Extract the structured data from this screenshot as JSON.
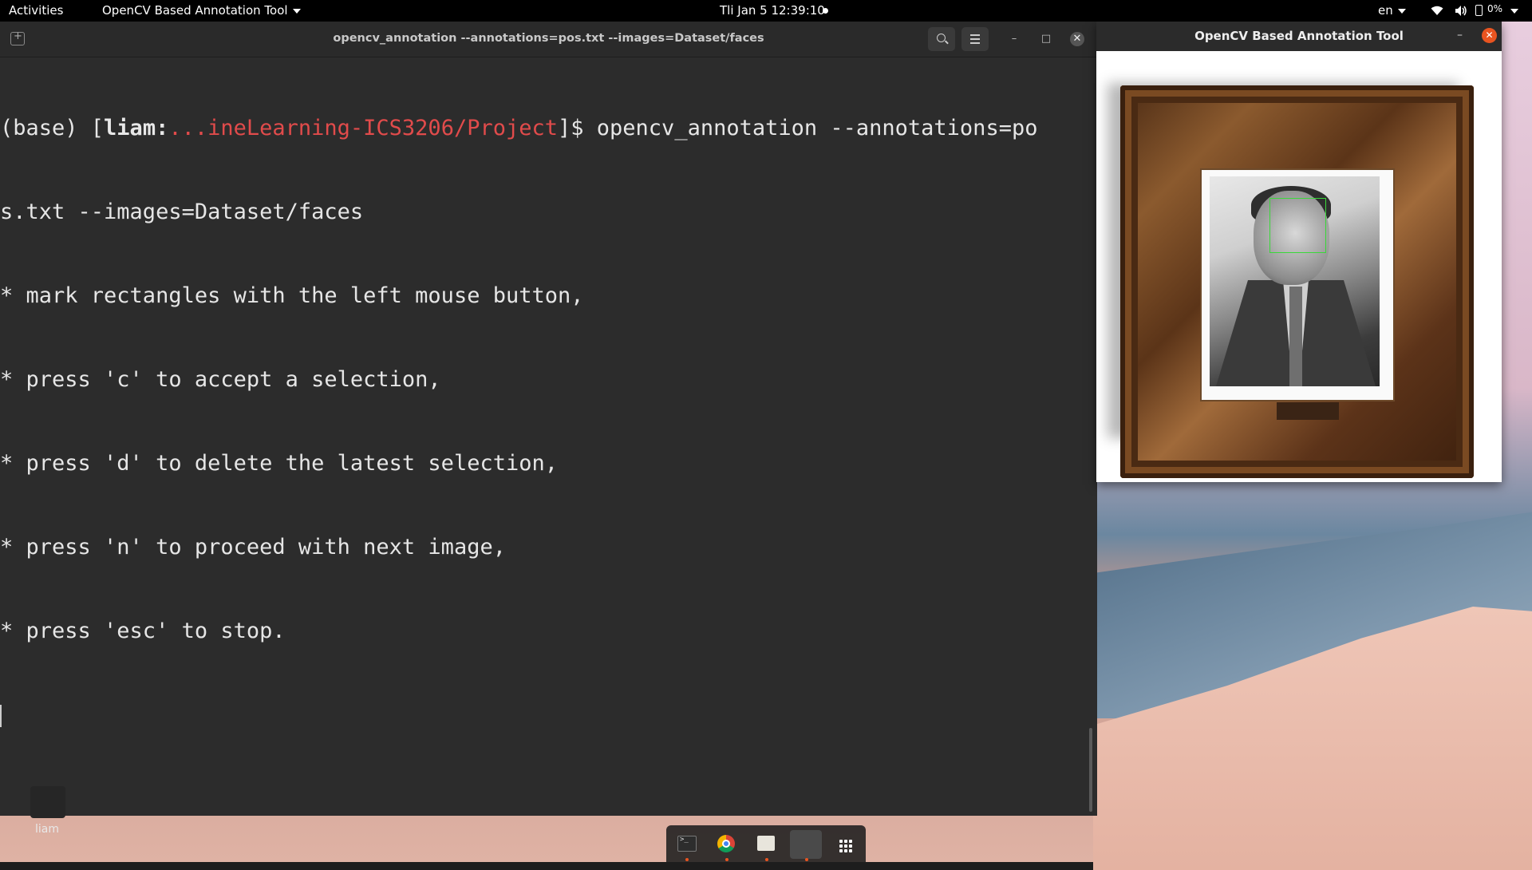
{
  "topbar": {
    "activities": "Activities",
    "app_menu": "OpenCV Based Annotation Tool",
    "clock": "Tli Jan 5  12:39:10",
    "language": "en",
    "battery": "0%"
  },
  "terminal": {
    "title": "opencv_annotation --annotations=pos.txt --images=Dataset/faces",
    "prompt_env": "(base) [",
    "prompt_user": "liam:",
    "prompt_path": "...ineLearning-ICS3206/Project",
    "prompt_end": "]$ ",
    "command_part1": "opencv_annotation --annotations=po",
    "command_part2": "s.txt --images=Dataset/faces",
    "output": [
      "* mark rectangles with the left mouse button,",
      "* press 'c' to accept a selection,",
      "* press 'd' to delete the latest selection,",
      "* press 'n' to proceed with next image,",
      "* press 'esc' to stop."
    ]
  },
  "annotation_window": {
    "title": "OpenCV Based Annotation Tool"
  },
  "desktop": {
    "home_label": "liam"
  },
  "dock": {
    "items": [
      "terminal-icon",
      "chrome-icon",
      "files-icon",
      "opencv-window",
      "show-apps-icon"
    ]
  },
  "colors": {
    "prompt_path": "#e14b4b",
    "selection_box": "#39d839",
    "close_button": "#e95420"
  }
}
